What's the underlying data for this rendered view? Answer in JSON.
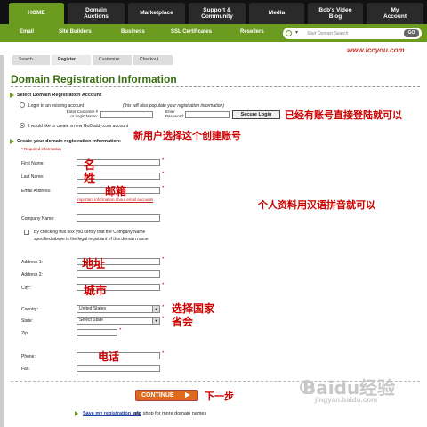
{
  "nav": {
    "tabs": [
      {
        "label": "HOME",
        "active": true
      },
      {
        "label": "Domain\nAuctions"
      },
      {
        "label": "Marketplace"
      },
      {
        "label": "Support &\nCommunity"
      },
      {
        "label": "Media"
      },
      {
        "label": "Bob's Video\nBlog"
      },
      {
        "label": "My\nAccount"
      }
    ]
  },
  "subnav": {
    "links": [
      "Email",
      "Site Builders",
      "Business",
      "SSL Certificates",
      "Resellers"
    ],
    "search_placeholder": "Start Domain Search",
    "search_drop": "▾",
    "go_label": "GO"
  },
  "logo": "www.lccyou.com",
  "steps": [
    "Search",
    "Register",
    "Customize",
    "Checkout"
  ],
  "page_title": "Domain Registration Information",
  "select_account": {
    "heading": "Select Domain Registration Account",
    "existing_label": "Login to an existing account",
    "existing_note": "(this will also populate your registration information)",
    "customer_label": "Enter Customer #\nor Login Name:",
    "password_label": "Enter\nPassword:",
    "secure_login": "Secure Login",
    "new_label": "I would like to create a new GoDaddy.com account"
  },
  "create": {
    "heading": "Create your domain registration information:",
    "required": "* Required information",
    "first_name": "First Name:",
    "last_name": "Last Name:",
    "email": "Email Address:",
    "email_info": "Important information about email accounts",
    "company": "Company Name:",
    "company_check": "By checking this box you certify that the Company Name\nspecified above is the legal registrant of this domain name.",
    "address1": "Address 1:",
    "address2": "Address 2:",
    "city": "City:",
    "country": "Country:",
    "country_value": "United States",
    "state": "State:",
    "state_value": "Select State",
    "zip": "Zip:",
    "phone": "Phone:",
    "fax": "Fax:"
  },
  "annotations": {
    "login_note": "已经有账号直接登陆就可以",
    "new_note": "新用户选择这个创建账号",
    "first": "名",
    "last": "姓",
    "email": "邮箱",
    "pinyin": "个人资料用汉语拼音就可以",
    "address": "地址",
    "city": "城市",
    "country": "选择国家",
    "province": "省会",
    "phone": "电话",
    "next": "下一步"
  },
  "continue_label": "CONTINUE",
  "save_link": "Save my registration info",
  "save_rest": "and shop for more domain names",
  "watermark": "Baidu经验",
  "watermark_sub": "jingyan.baidu.com",
  "colors": {
    "brand_green": "#6b9b1f",
    "annotation_red": "#cc0000",
    "continue_orange": "#e06a1b"
  }
}
